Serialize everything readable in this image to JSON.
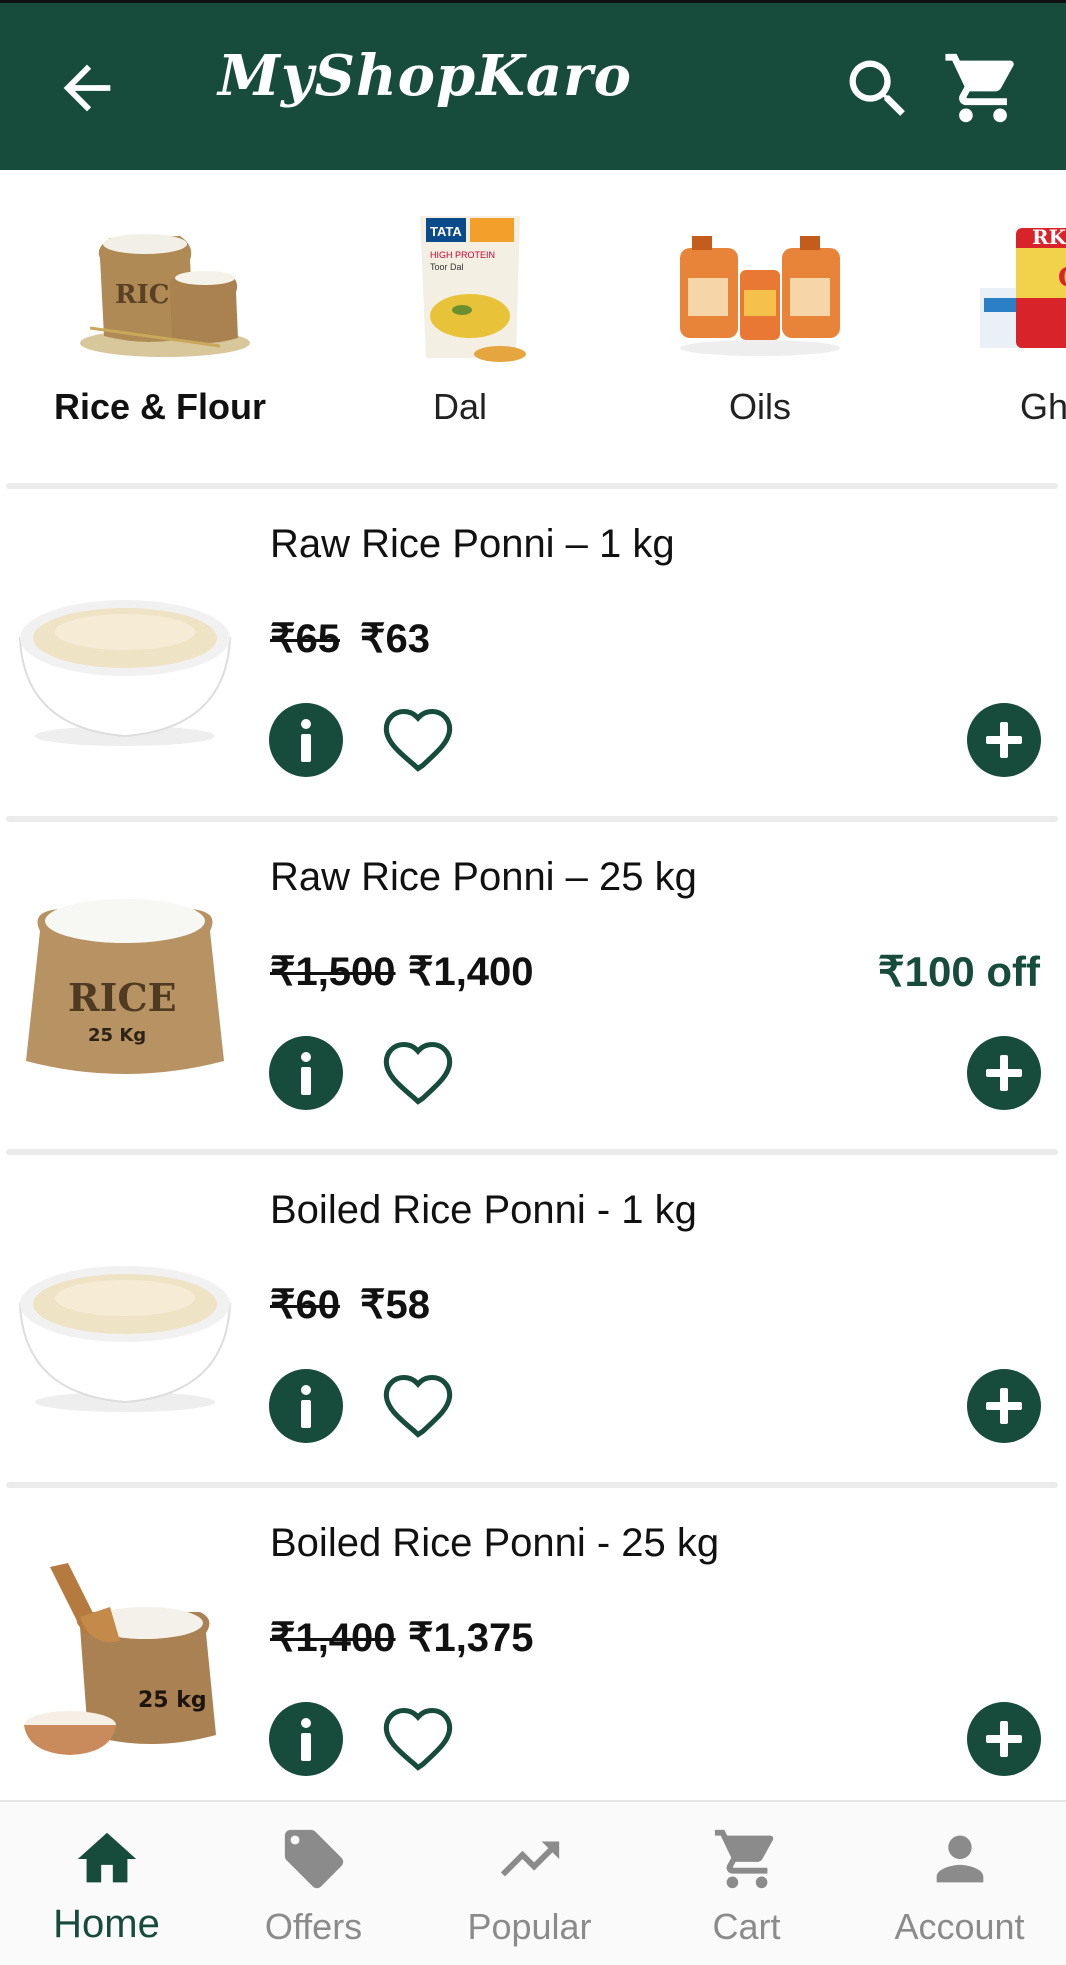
{
  "header": {
    "title": "MyShopKaro",
    "back_icon": "arrow-left-icon",
    "search_icon": "search-icon",
    "cart_icon": "cart-icon",
    "background": "#174c3c"
  },
  "categories": [
    {
      "label": "Rice & Flour",
      "icon": "rice-sack-image",
      "active": true
    },
    {
      "label": "Dal",
      "icon": "dal-packet-image",
      "active": false
    },
    {
      "label": "Oils",
      "icon": "oil-cans-image",
      "active": false
    },
    {
      "label": "Gh",
      "icon": "ghee-tin-image",
      "active": false
    }
  ],
  "products": [
    {
      "name": "Raw Rice Ponni – 1 kg",
      "old_price": "₹65",
      "price": "₹63",
      "discount": "",
      "image": "rice-bowl-image"
    },
    {
      "name": "Raw Rice Ponni – 25 kg",
      "old_price": "₹1,500",
      "price": "₹1,400",
      "discount": "₹100 off",
      "image": "rice-sack-25kg-image",
      "sack_text": "RICE",
      "sack_weight": "25 Kg"
    },
    {
      "name": "Boiled Rice Ponni - 1 kg",
      "old_price": "₹60",
      "price": "₹58",
      "discount": "",
      "image": "rice-bowl-image"
    },
    {
      "name": "Boiled Rice Ponni - 25 kg",
      "old_price": "₹1,400",
      "price": "₹1,375",
      "discount": "",
      "image": "rice-bag-scoop-image",
      "sack_weight": "25 kg"
    }
  ],
  "bottom_nav": [
    {
      "label": "Home",
      "icon": "home-icon",
      "active": true
    },
    {
      "label": "Offers",
      "icon": "tag-icon",
      "active": false
    },
    {
      "label": "Popular",
      "icon": "trending-icon",
      "active": false
    },
    {
      "label": "Cart",
      "icon": "cart-icon",
      "active": false
    },
    {
      "label": "Account",
      "icon": "account-icon",
      "active": false
    }
  ],
  "colors": {
    "primary": "#174c3c",
    "inactive": "#8b8b8b",
    "divider": "#ecebeb"
  }
}
